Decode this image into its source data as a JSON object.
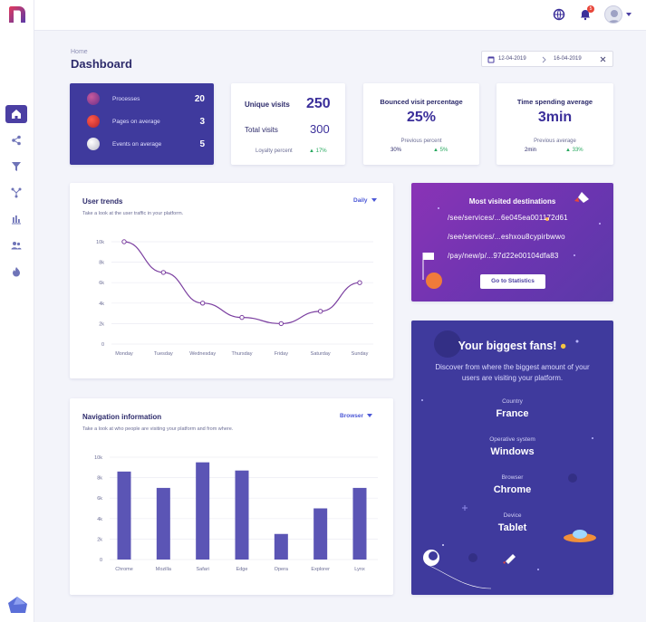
{
  "header": {
    "notifications_count": "5"
  },
  "breadcrumb": "Home",
  "page_title": "Dashboard",
  "date_range": {
    "start": "12-04-2019",
    "end": "16-04-2019"
  },
  "stats_card": {
    "rows": [
      {
        "label": "Processes",
        "value": "20"
      },
      {
        "label": "Pages on average",
        "value": "3"
      },
      {
        "label": "Events on average",
        "value": "5"
      }
    ]
  },
  "visits_card": {
    "unique_label": "Unique visits",
    "unique_value": "250",
    "total_label": "Total visits",
    "total_value": "300",
    "loyalty_label": "Loyalty percent",
    "loyalty_value": "▲ 17%"
  },
  "bounce_card": {
    "title": "Bounced visit percentage",
    "value": "25%",
    "prev_label": "Previous percent",
    "prev_value": "30%",
    "change": "▲ 5%"
  },
  "time_card": {
    "title": "Time spending average",
    "value": "3min",
    "prev_label": "Previous average",
    "prev_value": "2min",
    "change": "▲ 33%"
  },
  "user_trends": {
    "title": "User trends",
    "subtitle": "Take a look at the user traffic in your platform.",
    "dropdown": "Daily"
  },
  "navigation": {
    "title": "Navigation information",
    "subtitle": "Take a look at who people are visiting your platform and from where.",
    "dropdown": "Browser"
  },
  "destinations": {
    "title": "Most visited destinations",
    "paths": [
      "/see/services/...6e045ea001172d61",
      "/see/services/...eshxou8cypirbwwo",
      "/pay/new/p/...97d22e00104dfa83"
    ],
    "button": "Go to Statistics"
  },
  "fans": {
    "title": "Your biggest fans!",
    "description": "Discover from where the biggest amount of your users are visiting your platform.",
    "items": [
      {
        "label": "Country",
        "value": "France"
      },
      {
        "label": "Operative system",
        "value": "Windows"
      },
      {
        "label": "Browser",
        "value": "Chrome"
      },
      {
        "label": "Device",
        "value": "Tablet"
      }
    ]
  },
  "chart_data": [
    {
      "type": "line",
      "categories": [
        "Monday",
        "Tuesday",
        "Wednesday",
        "Thursday",
        "Friday",
        "Saturday",
        "Sunday"
      ],
      "values": [
        10000,
        7000,
        4000,
        2600,
        2000,
        3200,
        6000
      ],
      "yticks": [
        "0",
        "2k",
        "4k",
        "6k",
        "8k",
        "10k"
      ],
      "ylim": [
        0,
        10000
      ],
      "color": "#7b3fa0"
    },
    {
      "type": "bar",
      "categories": [
        "Chrome",
        "Mozilla",
        "Safari",
        "Edge",
        "Opera",
        "Explorer",
        "Lynx"
      ],
      "values": [
        8600,
        7000,
        9500,
        8700,
        2500,
        5000,
        7000
      ],
      "yticks": [
        "0",
        "2k",
        "4k",
        "6k",
        "8k",
        "10k"
      ],
      "ylim": [
        0,
        10000
      ],
      "color": "#5b55b5"
    }
  ]
}
